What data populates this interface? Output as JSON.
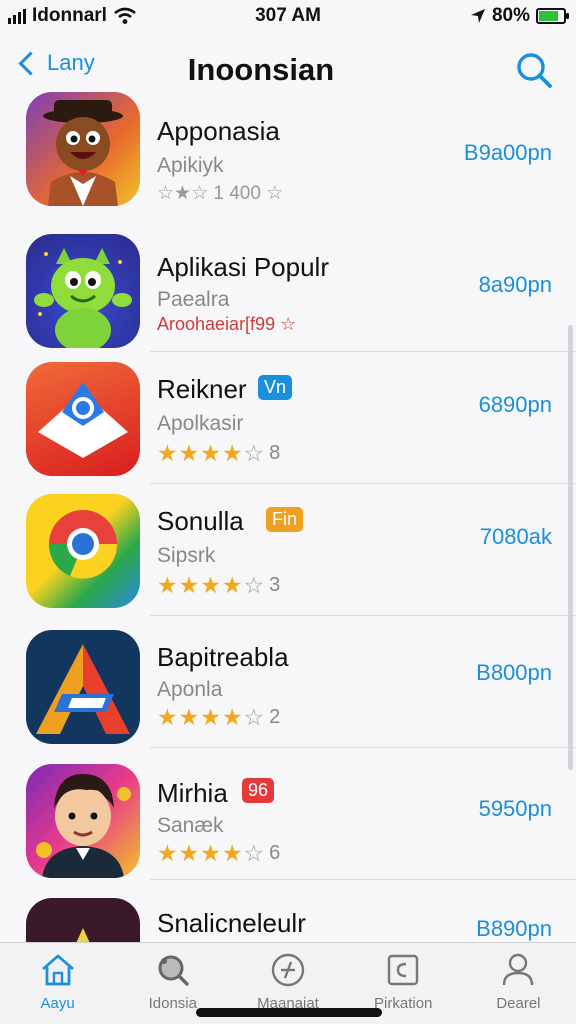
{
  "status_bar": {
    "carrier": "Idonnarl",
    "time": "307 AM",
    "battery": "80%",
    "battery_level": 0.8
  },
  "nav": {
    "back_label": "Lany",
    "title": "Inoonsian"
  },
  "apps": [
    {
      "name": "Apponasia",
      "subtitle": "Apikiyk",
      "rating_text": "☆★☆ 1 400 ☆",
      "price": "B9a00pn",
      "badge": ""
    },
    {
      "name": "Aplikasi Populr",
      "subtitle": "Paealra",
      "rating_text": "Aroohaeiar[f99 ☆",
      "price": "8a90pn",
      "badge": ""
    },
    {
      "name": "Reikner",
      "subtitle": "Apolkasir",
      "stars": 4,
      "count": "8",
      "price": "6890pn",
      "badge": "Vn",
      "badge_color": "#1a8fdc"
    },
    {
      "name": "Sonulla",
      "subtitle": "Sipsrk",
      "stars": 4,
      "count": "3",
      "price": "7080ak",
      "badge": "Fin",
      "badge_color": "#f0a020"
    },
    {
      "name": "Bapitreabla",
      "subtitle": "Aponla",
      "stars": 4,
      "count": "2",
      "price": "B800pn",
      "badge": ""
    },
    {
      "name": "Mirhia",
      "subtitle": "Sanæk",
      "stars": 4,
      "count": "6",
      "price": "5950pn",
      "badge": "96",
      "badge_color": "#e43a3a"
    },
    {
      "name": "Snalicneleulr",
      "subtitle": "",
      "price": "B890pn",
      "badge": ""
    }
  ],
  "tabs": [
    {
      "label": "Aayu",
      "icon": "home-icon",
      "active": true
    },
    {
      "label": "Idonsia",
      "icon": "discover-icon",
      "active": false
    },
    {
      "label": "Maanaiat",
      "icon": "games-icon",
      "active": false
    },
    {
      "label": "Pirkation",
      "icon": "apps-icon",
      "active": false
    },
    {
      "label": "Dearel",
      "icon": "person-icon",
      "active": false
    }
  ],
  "colors": {
    "accent": "#1a8fdc",
    "star": "#f3a81c"
  }
}
